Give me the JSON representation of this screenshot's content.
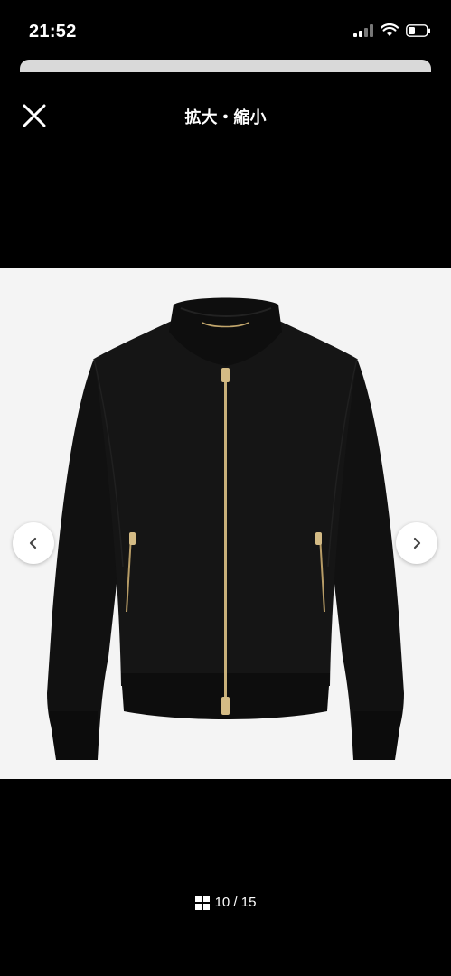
{
  "status": {
    "time": "21:52"
  },
  "header": {
    "title": "拡大・縮小"
  },
  "viewer": {
    "image_alt": "black bomber jacket with gold zipper",
    "counter": "10 / 15"
  },
  "icons": {
    "close": "close-icon",
    "prev": "chevron-left-icon",
    "next": "chevron-right-icon",
    "grid": "grid-icon"
  }
}
